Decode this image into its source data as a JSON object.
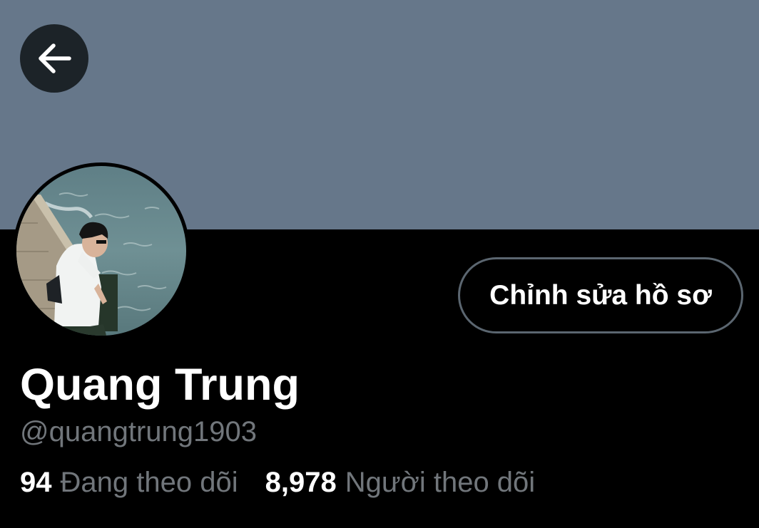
{
  "profile": {
    "display_name": "Quang Trung",
    "handle": "@quangtrung1903",
    "edit_button_label": "Chỉnh sửa hồ sơ",
    "following_count": "94",
    "following_label": "Đang theo dõi",
    "followers_count": "8,978",
    "followers_label": "Người theo dõi"
  },
  "icons": {
    "back": "arrow-left-icon"
  },
  "colors": {
    "banner": "#66778a",
    "background": "#000000",
    "secondary_text": "#71767b",
    "button_border": "#5b6670"
  }
}
